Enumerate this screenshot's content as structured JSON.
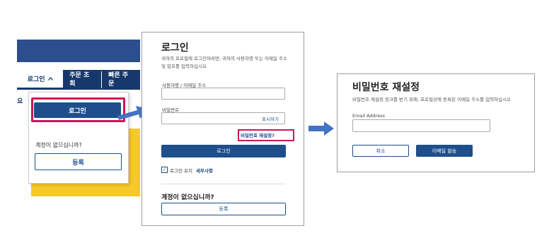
{
  "panel1": {
    "nav_active_label": "로그인",
    "nav_items": [
      "주문 조회",
      "빠른 주문"
    ],
    "edge_text": "요",
    "login_button": "로그인",
    "no_account_text": "계정이 없으십니까?",
    "register_button": "등록",
    "highlight_color": "#d0135a",
    "accent_color": "#1e4e8c",
    "banner_color": "#f7c928"
  },
  "panel2": {
    "title": "로그인",
    "description": "귀하의 프로필에 로그인하려면, 귀하의 사용자명 또는 이메일 주소 및 암호를 입력하십시오",
    "username_label": "사용자명 / 이메일 주소",
    "username_value": "",
    "password_label": "비밀번호",
    "password_value": "",
    "show_password": "표시하기",
    "forgot_password_link": "비밀번호 재설정?",
    "login_button": "로그인",
    "remember_me": "로그인 유지",
    "details_link": "세부사항",
    "no_account_heading": "계정이 없으십니까?",
    "register_button": "등록"
  },
  "panel3": {
    "title": "비밀번호 재설정",
    "description": "비밀번호 재설정 링크를 받기 위해, 프로필상에 등록된 이메일 주소를 입력하십시오",
    "email_label": "Email Address",
    "email_value": "",
    "cancel_button": "취소",
    "send_email_button": "이메일 발송"
  }
}
